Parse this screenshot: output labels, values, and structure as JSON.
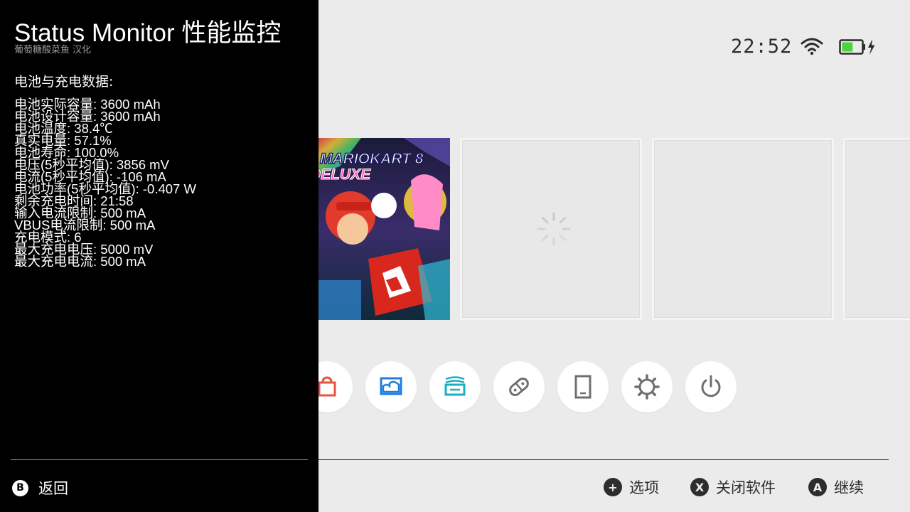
{
  "status_bar": {
    "time": "22:52",
    "wifi_icon": "wifi-icon",
    "battery_icon": "battery-charging-icon",
    "battery_level": 0.57,
    "battery_color": "#4cd43c"
  },
  "game_tile": {
    "title_line1": "MARIOKART 8",
    "title_line2": "DELUXE"
  },
  "dock_icons": [
    "shop-icon",
    "album-icon",
    "news-icon",
    "controllers-icon",
    "console-icon",
    "settings-icon",
    "power-icon"
  ],
  "colors": {
    "shop": "#e8533f",
    "album": "#1e7fe0",
    "news": "#1ab0c2",
    "gray_icon": "#6f6f6f",
    "panel_bg": "#000000",
    "home_bg": "#ebebeb"
  },
  "footer_hints": [
    {
      "button": "+",
      "label": "选项"
    },
    {
      "button": "X",
      "label": "关闭软件"
    },
    {
      "button": "A",
      "label": "继续"
    }
  ],
  "overlay": {
    "title": "Status Monitor 性能监控",
    "subtitle": "葡萄糖酸菜鱼 汉化",
    "section_title": "电池与充电数据:",
    "stats": [
      "电池实际容量: 3600 mAh",
      "电池设计容量: 3600 mAh",
      "电池温度: 38.4℃",
      "真实电量: 57.1%",
      "电池寿命: 100.0%",
      "电压(5秒平均值): 3856 mV",
      "电流(5秒平均值): -106 mA",
      "电池功率(5秒平均值): -0.407 W",
      "剩余充电时间: 21:58",
      "输入电流限制: 500 mA",
      "VBUS电流限制: 500 mA",
      "充电模式: 6",
      "最大充电电压: 5000 mV",
      "最大充电电流: 500 mA"
    ],
    "back_button": "B",
    "back_label": "返回"
  }
}
